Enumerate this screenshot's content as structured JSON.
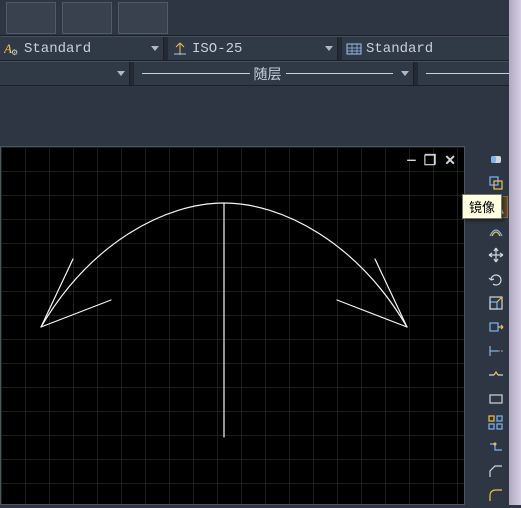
{
  "dropdowns": {
    "textstyle": "Standard",
    "dimstyle": "ISO-25",
    "tablestyle": "Standard",
    "layerstate": "",
    "linetype": "随层"
  },
  "tooltip": "镜像",
  "wincontrols": {
    "min": "—",
    "restore": "❐",
    "close": "✕"
  },
  "tools": [
    {
      "name": "eraser-icon"
    },
    {
      "name": "copy-icon"
    },
    {
      "name": "mirror-icon"
    },
    {
      "name": "offset-icon"
    },
    {
      "name": "move-icon"
    },
    {
      "name": "rotate-icon"
    },
    {
      "name": "scale-icon"
    },
    {
      "name": "stretch-icon"
    },
    {
      "name": "trim-icon"
    },
    {
      "name": "break-icon"
    },
    {
      "name": "rectangle-icon"
    },
    {
      "name": "array-icon"
    },
    {
      "name": "join-icon"
    },
    {
      "name": "chamfer-icon"
    },
    {
      "name": "fillet-icon"
    }
  ]
}
